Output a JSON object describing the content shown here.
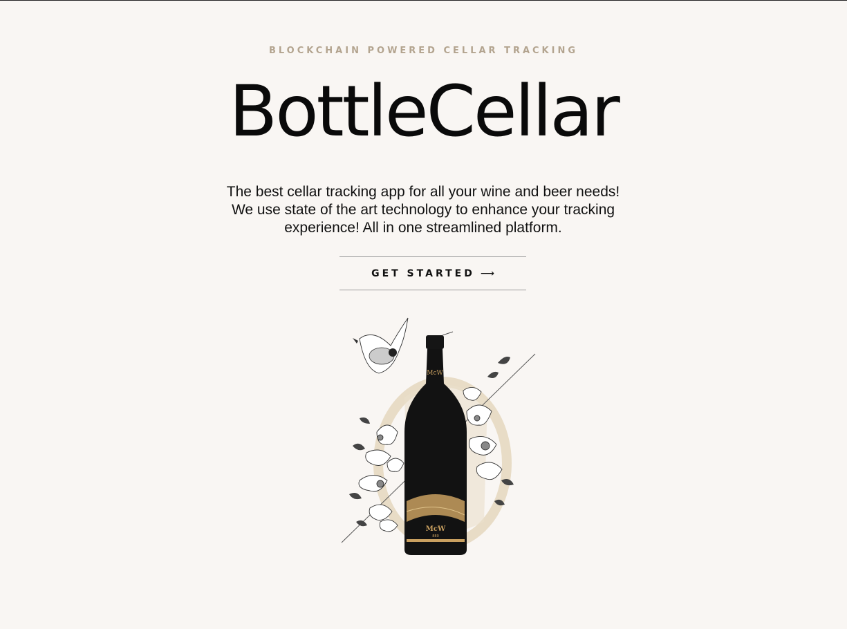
{
  "hero": {
    "eyebrow": "BLOCKCHAIN POWERED CELLAR TRACKING",
    "brand": "BottleCellar",
    "tagline": "The best cellar tracking app for all your wine and beer needs! We use state of the art technology to enhance your tracking experience! All in one streamlined platform.",
    "cta_label": "GET STARTED",
    "cta_arrow": "⟶"
  },
  "illustration": {
    "bottle_label_top": "McW",
    "bottle_label_main": "McW",
    "bottle_label_sub": "880"
  },
  "colors": {
    "background": "#f9f6f3",
    "accent": "#b3a48f",
    "text": "#111111",
    "circle": "#e6d9c3",
    "bottle": "#121212",
    "gold": "#c9a060"
  }
}
